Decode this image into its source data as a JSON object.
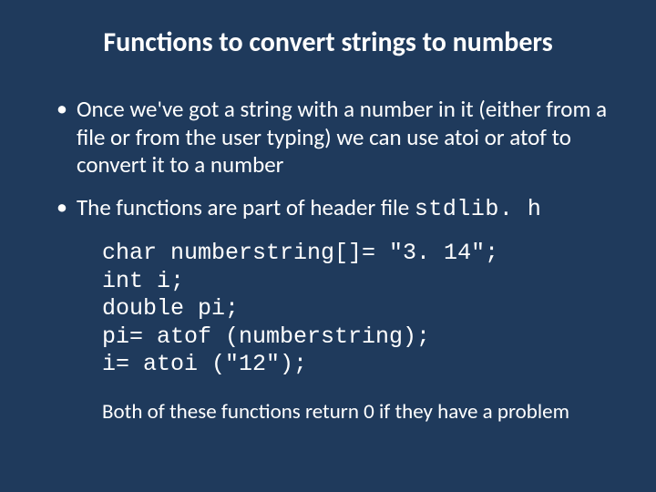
{
  "title": "Functions to convert strings to numbers",
  "bullets": [
    {
      "text": "Once we've got a string with a number in it (either from a file or from the user typing) we can use atoi or atof to convert it to a number"
    },
    {
      "prefix": "The functions are part of header file ",
      "code": "stdlib. h"
    }
  ],
  "code": "char numberstring[]= \"3. 14\";\nint i;\ndouble pi;\npi= atof (numberstring);\ni= atoi (\"12\");",
  "footnote": "Both of these functions return 0 if they have a problem"
}
